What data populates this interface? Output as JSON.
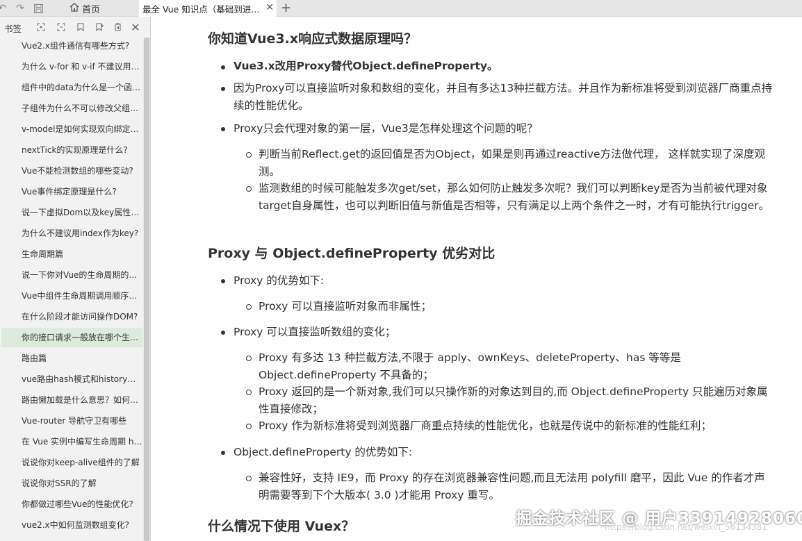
{
  "tabs": {
    "home_label": "首页",
    "active_title": "最全 Vue 知识点（基础到进...",
    "close_glyph": "✕",
    "new_tab_glyph": "+"
  },
  "sidebar": {
    "title": "书签",
    "items": [
      {
        "label": "Vue2.x组件通信有哪些方式?"
      },
      {
        "label": "为什么 v-for 和 v-if 不建议用在一起"
      },
      {
        "label": "组件中的data为什么是一个函数?"
      },
      {
        "label": "子组件为什么不可以修改父组件传递的Prop?"
      },
      {
        "label": "v-model是如何实现双向绑定的?"
      },
      {
        "label": "nextTick的实现原理是什么?"
      },
      {
        "label": "Vue不能检测数组的哪些变动?"
      },
      {
        "label": "Vue事件绑定原理是什么?"
      },
      {
        "label": "说一下虚拟Dom以及key属性的作用"
      },
      {
        "label": "为什么不建议用index作为key?"
      },
      {
        "label": "生命周期篇"
      },
      {
        "label": "说一下你对Vue的生命周期的理解"
      },
      {
        "label": "Vue中组件生命周期调用顺序说一下"
      },
      {
        "label": "在什么阶段才能访问操作DOM?"
      },
      {
        "label": "你的接口请求一般放在哪个生命周期中?"
      },
      {
        "label": "路由篇"
      },
      {
        "label": "vue路由hash模式和history模式实现原理"
      },
      {
        "label": "路由懒加载是什么意思？如何实现路由懒加载"
      },
      {
        "label": "Vue-router 导航守卫有哪些"
      },
      {
        "label": "在 Vue 实例中编写生命周期 hook"
      },
      {
        "label": "说说你对keep-alive组件的了解"
      },
      {
        "label": "说说你对SSR的了解"
      },
      {
        "label": "你都做过哪些Vue的性能优化?"
      },
      {
        "label": "vue2.x中如何监测数组变化?"
      }
    ]
  },
  "content": {
    "h_reactive": "你知道Vue3.x响应式数据原理吗？",
    "b1": "Vue3.x改用Proxy替代Object.defineProperty。",
    "b2": "因为Proxy可以直接监听对象和数组的变化，并且有多达13种拦截方法。并且作为新标准将受到浏览器厂商重点持续的性能优化。",
    "b3": "Proxy只会代理对象的第一层，Vue3是怎样处理这个问题的呢？",
    "b3_1": "判断当前Reflect.get的返回值是否为Object，如果是则再通过reactive方法做代理， 这样就实现了深度观测。",
    "b3_2": "监测数组的时候可能触发多次get/set，那么如何防止触发多次呢？我们可以判断key是否为当前被代理对象target自身属性，也可以判断旧值与新值是否相等，只有满足以上两个条件之一时，才有可能执行trigger。",
    "h_compare": "Proxy 与 Object.defineProperty 优劣对比",
    "c1": "Proxy 的优势如下:",
    "c1_1": "Proxy 可以直接监听对象而非属性；",
    "c2": "Proxy 可以直接监听数组的变化；",
    "c2_1": "Proxy 有多达 13 种拦截方法,不限于 apply、ownKeys、deleteProperty、has 等等是 Object.defineProperty 不具备的；",
    "c2_2": "Proxy 返回的是一个新对象,我们可以只操作新的对象达到目的,而 Object.defineProperty 只能遍历对象属性直接修改；",
    "c2_3": "Proxy 作为新标准将受到浏览器厂商重点持续的性能优化，也就是传说中的新标准的性能红利；",
    "c3": "Object.defineProperty 的优势如下:",
    "c3_1": "兼容性好，支持 IE9，而 Proxy 的存在浏览器兼容性问题,而且无法用 polyfill 磨平，因此 Vue 的作者才声明需要等到下个大版本( 3.0 )才能用 Proxy 重写。",
    "h_vuex": "什么情况下使用 Vuex？"
  },
  "watermark": {
    "main": "掘金技术社区 @ 用户3391492806O",
    "url": "https://blog.csdn.net/weixin_56134381"
  }
}
